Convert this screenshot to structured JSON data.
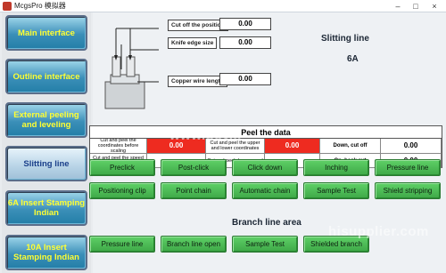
{
  "window": {
    "title": "McgsPro 模拟器",
    "minimize": "–",
    "maximize": "□",
    "close": "×"
  },
  "nav": {
    "items": [
      {
        "label": "Main interface"
      },
      {
        "label": "Outline interface"
      },
      {
        "label": "External peeling and leveling"
      },
      {
        "label": "Slitting line"
      },
      {
        "label": "6A Insert Stamping Indian"
      },
      {
        "label": "10A Insert Stamping Indian"
      }
    ]
  },
  "fields": {
    "cut_off_position": {
      "label": "Cut off the position",
      "value": "0.00"
    },
    "knife_edge_size": {
      "label": "Knife edge size",
      "value": "0.00"
    },
    "copper_wire_length": {
      "label": "Copper wire length",
      "value": "0.00"
    }
  },
  "header": {
    "title": "Slitting line",
    "subtitle": "6A"
  },
  "peel": {
    "title": "Peel the data",
    "c1": "Cut and peel the coordinates before scaling",
    "c2": "Cut and peel the upper and lower coordinates",
    "c3": "Down, cut off",
    "c3_value": "0.00",
    "c4": "Cut and peel the speed before and after",
    "c5": "Cut and peel down speed",
    "c6": "On, back cut",
    "c6_value": "0.00",
    "red1": "0.00",
    "red2": "0.00"
  },
  "buttons": {
    "row1": [
      "Preclick",
      "Post-click",
      "Click down",
      "Inching",
      "Pressure line"
    ],
    "row2": [
      "Positioning clip",
      "Point chain",
      "Automatic chain",
      "Sample Test",
      "Shield stripping"
    ],
    "row3": [
      "Pressure line",
      "Branch line open",
      "Sample Test",
      "Shielded branch"
    ]
  },
  "branch": {
    "title": "Branch line area"
  },
  "watermarks": [
    "www.bev...",
    "hisupplier.com"
  ]
}
